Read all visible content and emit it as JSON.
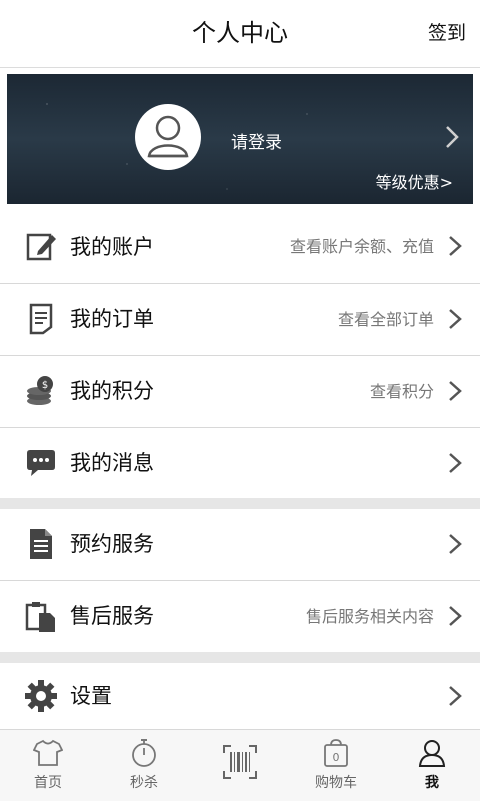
{
  "header": {
    "title": "个人中心",
    "signin": "签到"
  },
  "profile": {
    "login_label": "请登录",
    "level_link": "等级优惠>"
  },
  "menu": [
    {
      "label": "我的账户",
      "hint": "查看账户余额、充值",
      "icon": "edit-icon"
    },
    {
      "label": "我的订单",
      "hint": "查看全部订单",
      "icon": "document-icon"
    },
    {
      "label": "我的积分",
      "hint": "查看积分",
      "icon": "coins-icon"
    },
    {
      "label": "我的消息",
      "hint": "",
      "icon": "chat-bubble-icon"
    },
    {
      "label": "预约服务",
      "hint": "",
      "icon": "file-icon"
    },
    {
      "label": "售后服务",
      "hint": "售后服务相关内容",
      "icon": "clipboard-icon"
    },
    {
      "label": "设置",
      "hint": "",
      "icon": "gear-icon"
    }
  ],
  "tabs": [
    {
      "label": "首页",
      "icon": "tshirt-icon"
    },
    {
      "label": "秒杀",
      "icon": "stopwatch-icon"
    },
    {
      "label": "",
      "icon": "barcode-scan-icon"
    },
    {
      "label": "购物车",
      "icon": "cart-bag-icon"
    },
    {
      "label": "我",
      "icon": "person-icon"
    }
  ]
}
